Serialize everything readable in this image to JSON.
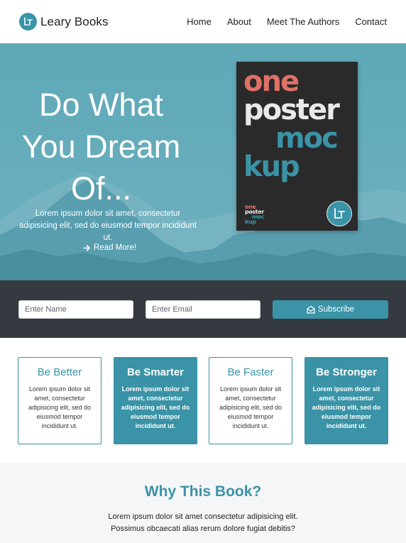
{
  "nav": {
    "brand": "Leary Books",
    "links": [
      "Home",
      "About",
      "Meet The Authors",
      "Contact"
    ]
  },
  "hero": {
    "title_lines": [
      "Do What",
      "You Dream",
      "Of..."
    ],
    "text": "Lorem ipsum dolor sit amet, consectetur adipisicing elit, sed do eiusmod tempor incididunt ut.",
    "read_more": "Read More!",
    "poster": {
      "words": [
        "one",
        "poster",
        "moc",
        "kup"
      ]
    }
  },
  "subscribe": {
    "name_placeholder": "Enter Name",
    "email_placeholder": "Enter Email",
    "button": "Subscribe"
  },
  "features": [
    {
      "title": "Be Better",
      "text": "Lorem ipsum dolor sit amet, consectetur adipisicing elit, sed do eiusmod tempor incididunt ut."
    },
    {
      "title": "Be Smarter",
      "text": "Lorem ipsum dolor sit amet, consectetur adipisicing elit, sed do eiusmod tempor incididunt ut."
    },
    {
      "title": "Be Faster",
      "text": "Lorem ipsum dolor sit amet, consectetur adipisicing elit, sed do eiusmod tempor incididunt ut."
    },
    {
      "title": "Be Stronger",
      "text": "Lorem ipsum dolor sit amet, consectetur adipisicing elit, sed do eiusmod tempor incididunt ut."
    }
  ],
  "why": {
    "title": "Why This Book?",
    "text_lines": [
      "Lorem ipsum dolor sit amet consectetur adipisicing elit.",
      "Possimus obcaecati alias rerum dolore fugiat debitis?"
    ]
  },
  "colors": {
    "primary": "#3a93a6",
    "dark": "#343a40",
    "hero": "#5aa6b7",
    "poster_bg": "#2a2a2b",
    "poster_accent": "#e07068"
  },
  "icons": {
    "brand_logo": "lr-logo-icon",
    "read_more": "arrow-right-icon",
    "subscribe": "envelope-open-icon"
  }
}
